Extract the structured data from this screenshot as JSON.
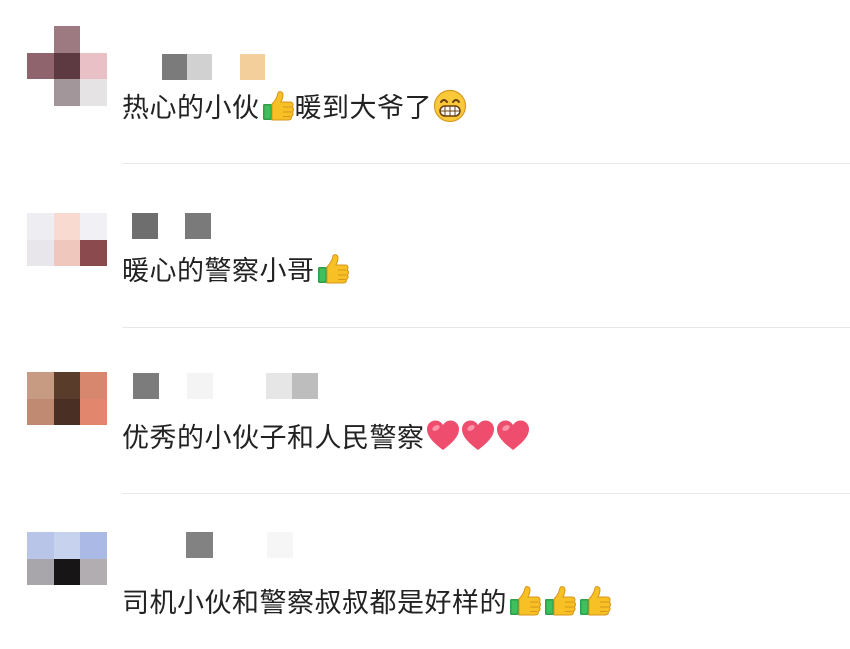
{
  "comments": [
    {
      "text_a": "热心的小伙",
      "text_b": "暖到大爷了",
      "emoji_a": "thumbs-up",
      "emoji_b": "grinning-face"
    },
    {
      "text_a": "暖心的警察小哥",
      "emoji_a": "thumbs-up"
    },
    {
      "text_a": "优秀的小伙子和人民警察",
      "emoji_a": "red-heart",
      "emoji_count": 3
    },
    {
      "text_a": "司机小伙和警察叔叔都是好样的",
      "emoji_a": "thumbs-up",
      "emoji_count": 3
    }
  ]
}
